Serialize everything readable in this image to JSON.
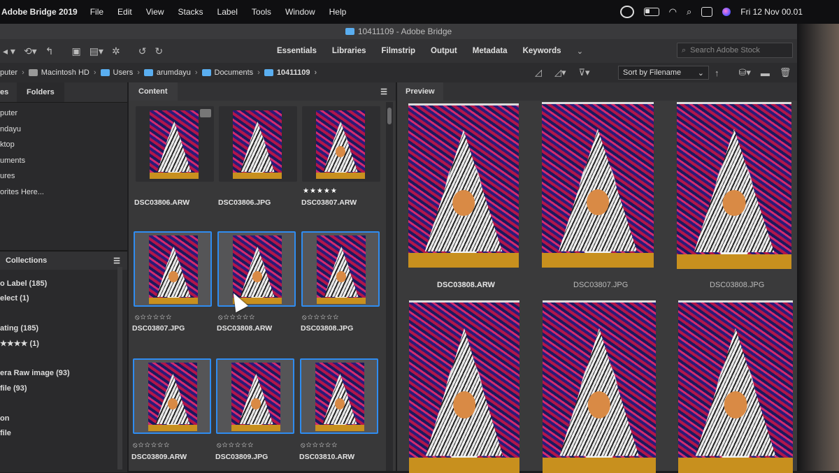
{
  "menubar": {
    "app": "Adobe Bridge 2019",
    "items": [
      "File",
      "Edit",
      "View",
      "Stacks",
      "Label",
      "Tools",
      "Window",
      "Help"
    ],
    "clock": "Fri 12 Nov  00.01"
  },
  "window": {
    "title": "10411109 - Adobe Bridge"
  },
  "workspaces": [
    "Essentials",
    "Libraries",
    "Filmstrip",
    "Output",
    "Metadata",
    "Keywords"
  ],
  "search": {
    "placeholder": "Search Adobe Stock"
  },
  "path": [
    "puter",
    "Macintosh HD",
    "Users",
    "arumdayu",
    "Documents",
    "10411109"
  ],
  "sort": {
    "label": "Sort by Filename"
  },
  "left_tabs": {
    "tab1": "es",
    "tab2": "Folders"
  },
  "favorites": [
    "puter",
    "ndayu",
    "ktop",
    "uments",
    "ures",
    "orites Here..."
  ],
  "collections": {
    "title": "Collections"
  },
  "filters": [
    "o Label (185)",
    "elect (1)",
    "",
    "ating (185)",
    "★★★★ (1)",
    "",
    "era Raw image (93)",
    "file (93)",
    "",
    "on",
    "file"
  ],
  "content": {
    "tab": "Content"
  },
  "thumbnails": [
    {
      "name": "DSC03806.ARW",
      "stars": "",
      "selected": false
    },
    {
      "name": "DSC03806.JPG",
      "stars": "",
      "selected": false
    },
    {
      "name": "DSC03807.ARW",
      "stars": "★★★★★",
      "selected": false
    },
    {
      "name": "DSC03807.JPG",
      "stars": "⦸☆☆☆☆☆",
      "selected": true
    },
    {
      "name": "DSC03808.ARW",
      "stars": "⦸☆☆☆☆☆",
      "selected": true
    },
    {
      "name": "DSC03808.JPG",
      "stars": "⦸☆☆☆☆☆",
      "selected": true
    },
    {
      "name": "DSC03809.ARW",
      "stars": "⦸☆☆☆☆☆",
      "selected": true
    },
    {
      "name": "DSC03809.JPG",
      "stars": "⦸☆☆☆☆☆",
      "selected": true
    },
    {
      "name": "DSC03810.ARW",
      "stars": "⦸☆☆☆☆☆",
      "selected": true
    }
  ],
  "preview": {
    "tab": "Preview",
    "labels": [
      "DSC03808.ARW",
      "DSC03807.JPG",
      "DSC03808.JPG"
    ]
  }
}
